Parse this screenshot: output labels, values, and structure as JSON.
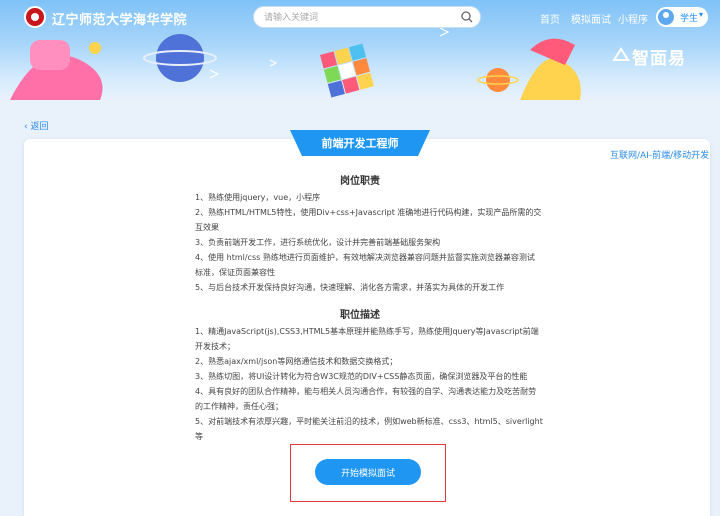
{
  "header": {
    "school_name": "辽宁师范大学海华学院",
    "search": {
      "placeholder": "请输入关键词"
    },
    "nav": [
      "首页",
      "模拟面试",
      "小程序"
    ],
    "user_label": "学生",
    "brand": "智面易"
  },
  "back_label": "返回",
  "job": {
    "title": "前端开发工程师",
    "tags": "互联网/AI-前端/移动开发"
  },
  "duties": {
    "heading": "岗位职责",
    "lines": [
      "1、熟练使用jquery，vue，小程序",
      "2、熟练HTML/HTML5特性，使用Div+css+Javascript 准确地进行代码构建，实现产品所需的交",
      "互效果",
      "3、负责前端开发工作，进行系统优化，设计并完善前端基础服务架构",
      "4、使用 html/css 熟练地进行页面维护，有效地解决浏览器兼容问题并监督实施浏览器兼容测试",
      "标准，保证页面兼容性",
      "5、与后台技术开发保持良好沟通，快速理解、消化各方需求，并落实为具体的开发工作"
    ]
  },
  "description": {
    "heading": "职位描述",
    "lines": [
      "1、精通JavaScript(js),CSS3,HTML5基本原理并能熟练手写，熟练使用Jquery等Javascript前端",
      "开发技术；",
      "2、熟悉ajax/xml/json等网络通信技术和数据交换格式；",
      "3、熟练切图，将UI设计转化为符合W3C规范的DIV+CSS静态页面，确保浏览器及平台的性能",
      "4、具有良好的团队合作精神，能与相关人员沟通合作，有较强的自学、沟通表达能力及吃苦耐劳",
      "的工作精神，责任心强；",
      "5、对前端技术有浓厚兴趣，平时能关注前沿的技术，例如web新标准、css3、html5、siverlight",
      "等"
    ]
  },
  "start_button": "开始模拟面试",
  "colors": {
    "primary": "#1e96f2",
    "link": "#2a8be6",
    "highlight_border": "#e33b3b",
    "background": "#e9f1fb"
  }
}
